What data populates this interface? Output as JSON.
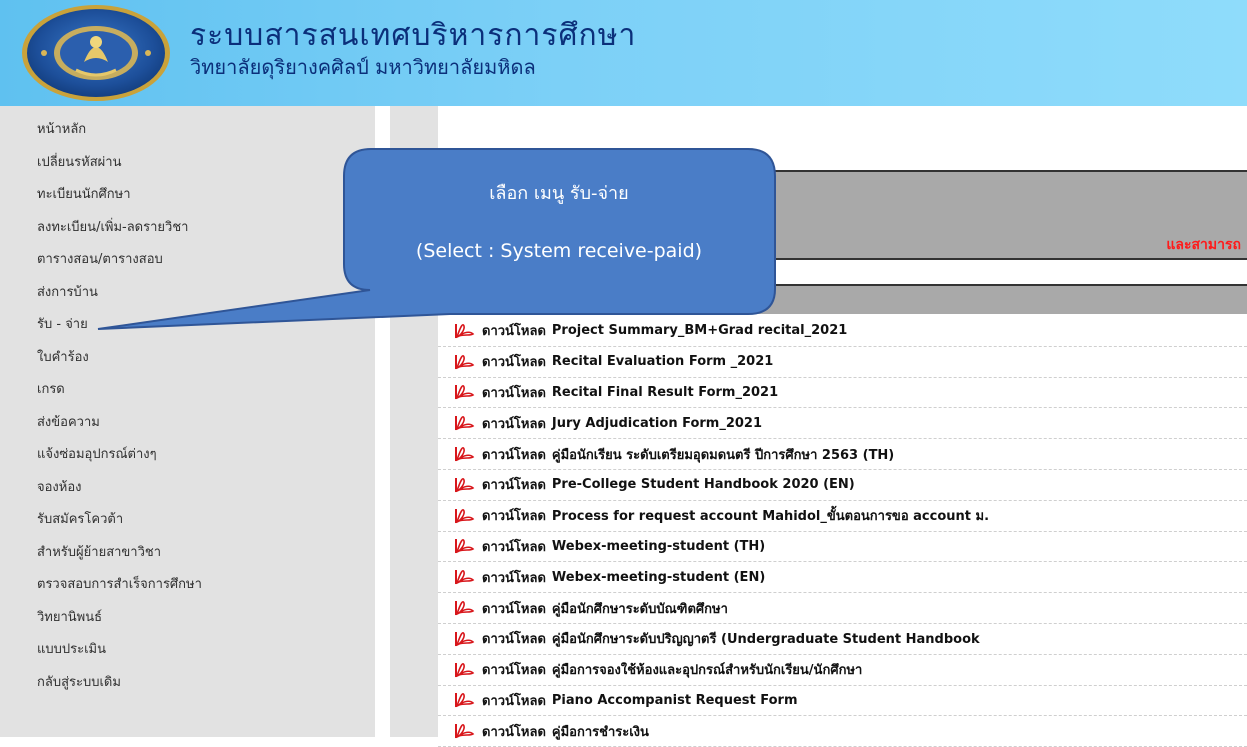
{
  "header": {
    "title": "ระบบสารสนเทศบริหารการศึกษา",
    "subtitle": "วิทยาลัยดุริยางคศิลป์ มหาวิทยาลัยมหิดล"
  },
  "sidebar": {
    "items": [
      {
        "label": "หน้าหลัก"
      },
      {
        "label": "เปลี่ยนรหัสผ่าน"
      },
      {
        "label": "ทะเบียนนักศึกษา"
      },
      {
        "label": "ลงทะเบียน/เพิ่ม-ลดรายวิชา"
      },
      {
        "label": "ตารางสอน/ตารางสอบ"
      },
      {
        "label": "ส่งการบ้าน"
      },
      {
        "label": "รับ - จ่าย"
      },
      {
        "label": "ใบคำร้อง"
      },
      {
        "label": "เกรด"
      },
      {
        "label": "ส่งข้อความ"
      },
      {
        "label": "แจ้งซ่อมอุปกรณ์ต่างๆ"
      },
      {
        "label": "จองห้อง"
      },
      {
        "label": "รับสมัครโควต้า"
      },
      {
        "label": "สำหรับผู้ย้ายสาขาวิชา"
      },
      {
        "label": "ตรวจสอบการสำเร็จการศึกษา"
      },
      {
        "label": "วิทยานิพนธ์"
      },
      {
        "label": "แบบประเมิน"
      },
      {
        "label": "กลับสู่ระบบเดิม"
      }
    ]
  },
  "banner": {
    "red_text": "และสามารถ"
  },
  "downloads": {
    "prefix": "ดาวน์โหลด",
    "items": [
      {
        "title": "Project Summary_BM+Grad recital_2021"
      },
      {
        "title": "Recital Evaluation Form _2021"
      },
      {
        "title": "Recital Final Result Form_2021"
      },
      {
        "title": "Jury Adjudication Form_2021"
      },
      {
        "title": "คู่มือนักเรียน ระดับเตรียมอุดมดนตรี ปีการศึกษา 2563 (TH)"
      },
      {
        "title": "Pre-College Student Handbook 2020 (EN)"
      },
      {
        "title": "Process for request account Mahidol_ขั้นตอนการขอ account ม."
      },
      {
        "title": "Webex-meeting-student (TH)"
      },
      {
        "title": "Webex-meeting-student (EN)"
      },
      {
        "title": "คู่มือนักศึกษาระดับบัณฑิตศึกษา"
      },
      {
        "title": "คู่มือนักศึกษาระดับปริญญาตรี (Undergraduate Student Handbook"
      },
      {
        "title": "คู่มือการจองใช้ห้องและอุปกรณ์สำหรับนักเรียน/นักศึกษา"
      },
      {
        "title": "Piano Accompanist Request Form"
      },
      {
        "title": "คู่มือการชำระเงิน"
      }
    ]
  },
  "callout": {
    "line1": "เลือก เมนู รับ-จ่าย",
    "line2": "(Select : System receive-paid)"
  },
  "colors": {
    "header_blue": "#7cd0f7",
    "sidebar_gray": "#e2e2e2",
    "banner_gray": "#a9a9a9",
    "callout_blue": "#4a7dc7",
    "red": "#ff1a1a",
    "title_navy": "#0b2f7a"
  }
}
